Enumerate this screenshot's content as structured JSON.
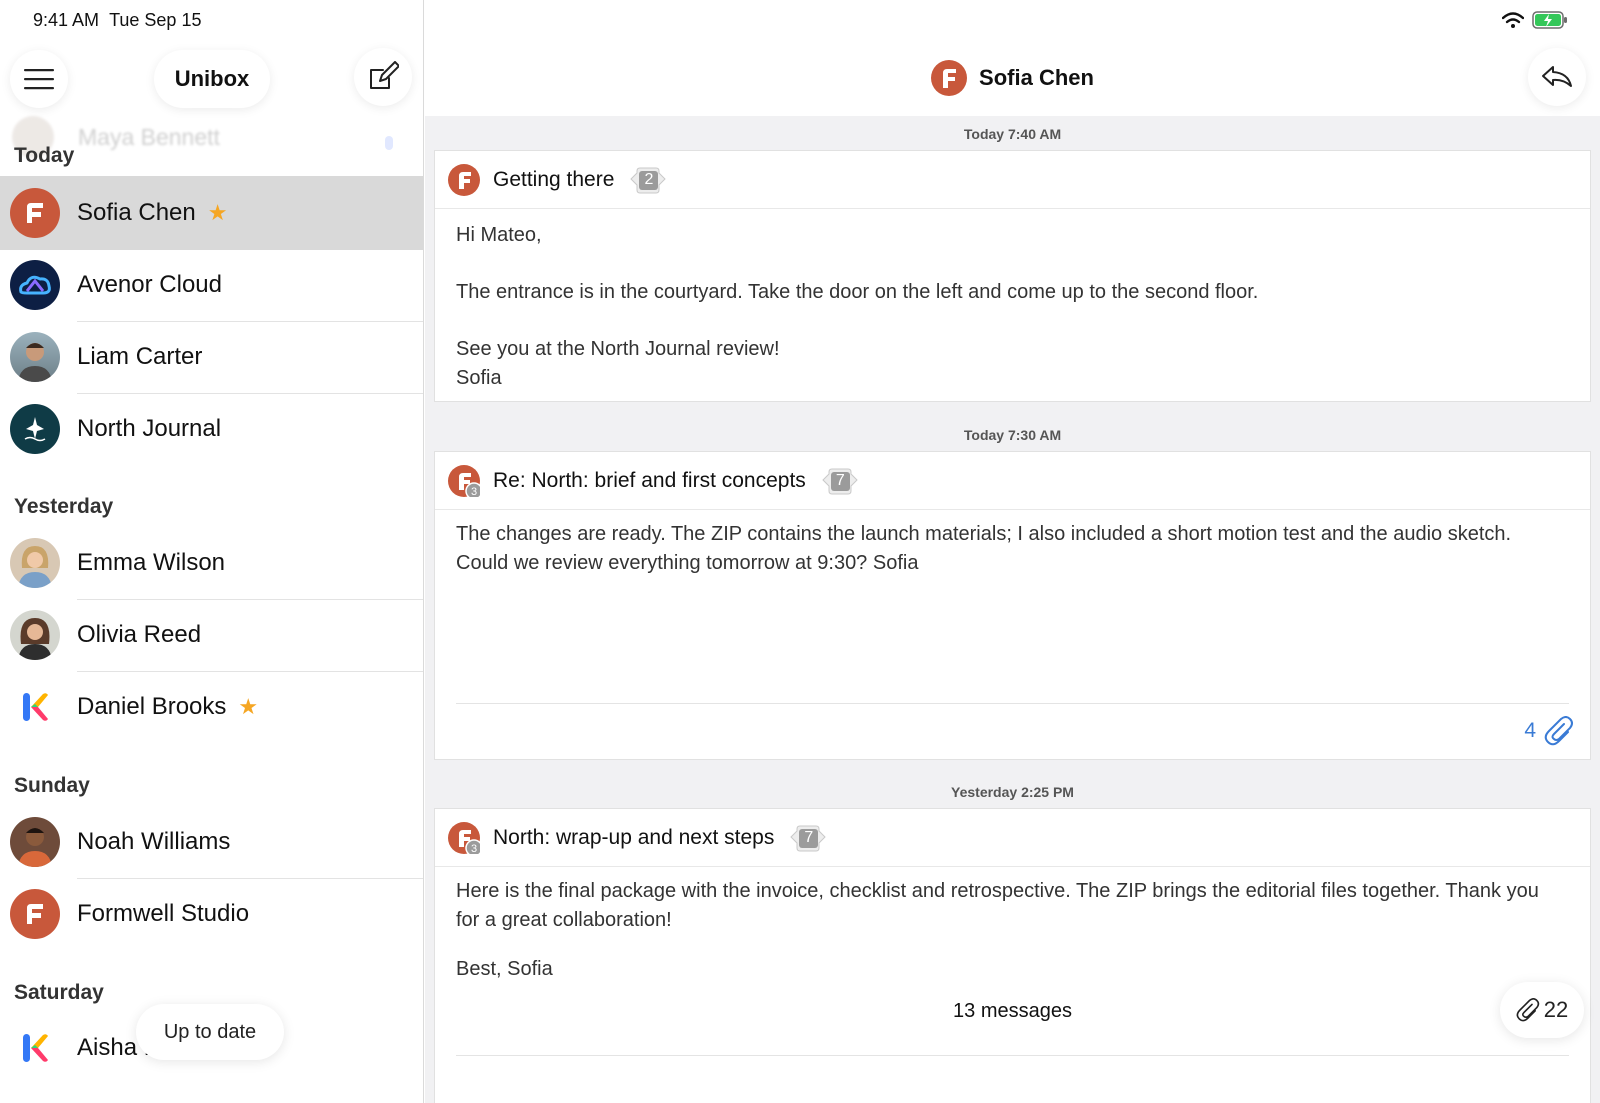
{
  "status": {
    "time": "9:41 AM",
    "date": "Tue Sep 15"
  },
  "sidebar": {
    "title": "Unibox",
    "ghost_name": "Maya Bennett",
    "sections": [
      {
        "label": "Today"
      },
      {
        "label": "Yesterday"
      },
      {
        "label": "Sunday"
      },
      {
        "label": "Saturday"
      }
    ],
    "items": [
      {
        "name": "Sofia Chen",
        "starred": true,
        "selected": true
      },
      {
        "name": "Avenor Cloud"
      },
      {
        "name": "Liam Carter"
      },
      {
        "name": "North Journal"
      },
      {
        "name": "Emma Wilson"
      },
      {
        "name": "Olivia Reed"
      },
      {
        "name": "Daniel Brooks",
        "starred": true
      },
      {
        "name": "Noah Williams"
      },
      {
        "name": "Formwell Studio"
      },
      {
        "name": "Aisha Rahman"
      }
    ],
    "up_to_date": "Up to date"
  },
  "conversation": {
    "title": "Sofia Chen",
    "messages": [
      {
        "timestamp": "Today 7:40 AM",
        "subject": "Getting there",
        "count": "2",
        "lines": [
          "Hi Mateo,",
          "The entrance is in the courtyard. Take the door on the left and come up to the second floor.",
          "See you at the North Journal review!",
          "Sofia"
        ]
      },
      {
        "timestamp": "Today 7:30 AM",
        "subject": "Re: North: brief and first concepts",
        "count": "7",
        "badge": "3",
        "lines": [
          "The changes are ready. The ZIP contains the launch materials; I also included a short motion test and the audio sketch. Could we review everything tomorrow at 9:30? Sofia"
        ],
        "attachments": "4"
      },
      {
        "timestamp": "Yesterday 2:25 PM",
        "subject": "North: wrap-up and next steps",
        "count": "7",
        "badge": "3",
        "lines": [
          "Here is the final package with the invoice, checklist and retrospective. The ZIP brings the editorial files together. Thank you for a great collaboration!",
          "Best, Sofia"
        ]
      }
    ],
    "message_count": "13 messages",
    "total_attachments": "22"
  },
  "colors": {
    "brand": "#c8583b",
    "accent": "#3a7bd5",
    "star": "#f5a623"
  }
}
